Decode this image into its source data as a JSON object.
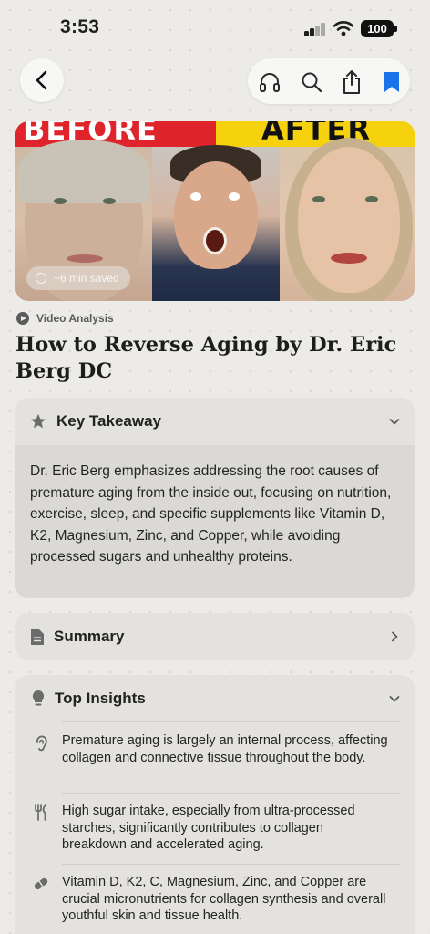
{
  "status_bar": {
    "time": "3:53",
    "battery": "100"
  },
  "nav": {
    "back_icon": "chevron-left-icon",
    "actions": [
      "headphones-icon",
      "search-icon",
      "share-icon",
      "bookmark-icon"
    ],
    "bookmark_color": "#1a73e8"
  },
  "hero": {
    "before_text": "BEFORE",
    "after_text": "AFTER",
    "time_saved": "~6 min saved",
    "banner_colors": {
      "before": "#e0242c",
      "after": "#f5d20d"
    }
  },
  "article": {
    "type_label": "Video Analysis",
    "title": "How to Reverse Aging by Dr. Eric Berg DC"
  },
  "key_takeaway": {
    "title": "Key Takeaway",
    "body": "Dr. Eric Berg emphasizes addressing the root causes of premature aging from the inside out, focusing on nutrition, exercise, sleep, and specific supplements like Vitamin D, K2, Magnesium, Zinc, and Copper, while avoiding processed sugars and unhealthy proteins."
  },
  "summary": {
    "title": "Summary"
  },
  "top_insights": {
    "title": "Top Insights",
    "items": [
      {
        "icon": "ear-icon",
        "text": "Premature aging is largely an internal process, affecting collagen and connective tissue throughout the body."
      },
      {
        "icon": "utensils-icon",
        "text": "High sugar intake, especially from ultra-processed starches, significantly contributes to collagen breakdown and accelerated aging."
      },
      {
        "icon": "pill-icon",
        "text": "Vitamin D, K2, C, Magnesium, Zinc, and Copper are crucial micronutrients for collagen synthesis and overall youthful skin and tissue health."
      }
    ]
  }
}
